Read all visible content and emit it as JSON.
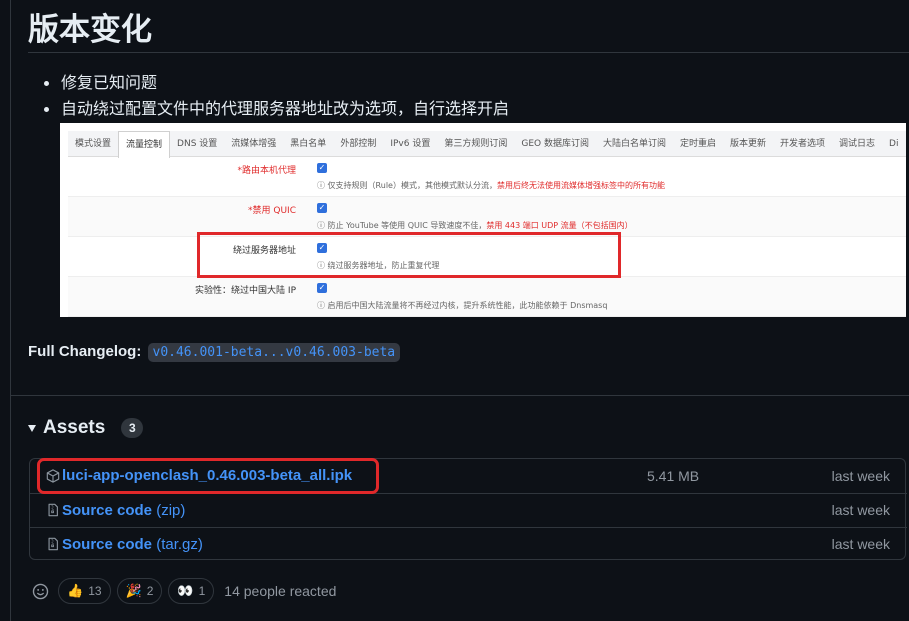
{
  "page": {
    "title": "版本变化",
    "notes": [
      "修复已知问题",
      "自动绕过配置文件中的代理服务器地址改为选项，自行选择开启"
    ]
  },
  "screenshot": {
    "tabs": [
      "模式设置",
      "流量控制",
      "DNS 设置",
      "流媒体增强",
      "黑白名单",
      "外部控制",
      "IPv6 设置",
      "第三方规则订阅",
      "GEO 数据库订阅",
      "大陆白名单订阅",
      "定时重启",
      "版本更新",
      "开发者选项",
      "调试日志",
      "Di"
    ],
    "active_tab": "流量控制",
    "options": [
      {
        "label": "*路由本机代理",
        "desc": "仅支持规则（Rule）模式，其他模式默认分流，",
        "warn": "禁用后终无法使用流媒体增强标签中的所有功能"
      },
      {
        "label": "*禁用 QUIC",
        "desc": "防止 YouTube 等使用 QUIC 导致速度不佳，",
        "warn": "禁用 443 端口 UDP 流量（不包括国内）"
      },
      {
        "label": "绕过服务器地址",
        "desc": "绕过服务器地址，防止重复代理",
        "warn": ""
      },
      {
        "label": "实验性：绕过中国大陆 IP",
        "desc": "启用后中国大陆流量将不再经过内核，提升系统性能，此功能依赖于 Dnsmasq",
        "warn": ""
      }
    ]
  },
  "changelog": {
    "label": "Full Changelog:",
    "link": "v0.46.001-beta...v0.46.003-beta"
  },
  "assets": {
    "title": "Assets",
    "count": "3",
    "items": [
      {
        "name": "luci-app-openclash_0.46.003-beta_all.ipk",
        "kind": "",
        "size": "5.41 MB",
        "date": "last week",
        "icon": "package-icon"
      },
      {
        "name": "Source code",
        "kind": "(zip)",
        "size": "",
        "date": "last week",
        "icon": "file-zip-icon"
      },
      {
        "name": "Source code",
        "kind": "(tar.gz)",
        "size": "",
        "date": "last week",
        "icon": "file-zip-icon"
      }
    ]
  },
  "reactions": {
    "items": [
      {
        "emoji": "👍",
        "count": "13"
      },
      {
        "emoji": "🎉",
        "count": "2"
      },
      {
        "emoji": "👀",
        "count": "1"
      }
    ],
    "summary": "14 people reacted"
  },
  "colors": {
    "background": "#0d1117",
    "link": "#4493f8",
    "border": "#30363d",
    "highlight": "#e0282a"
  }
}
